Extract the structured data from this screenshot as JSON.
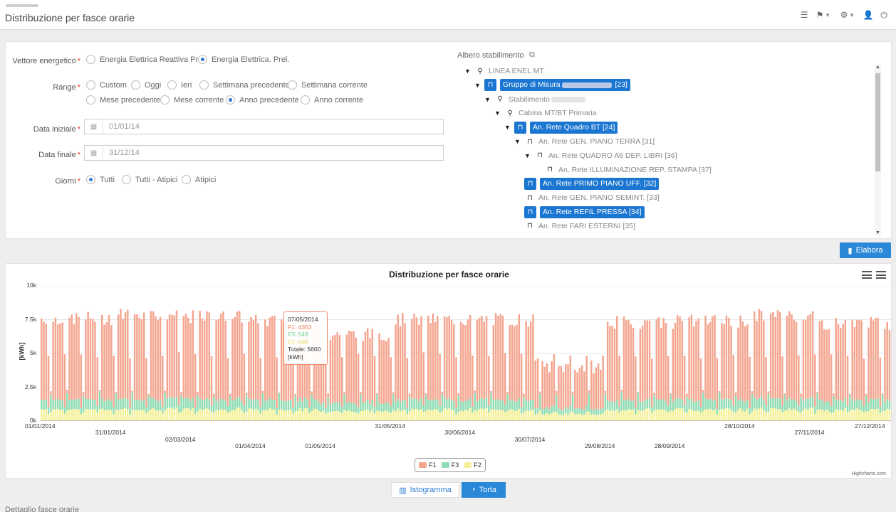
{
  "header": {
    "title": "Distribuzione per fasce orarie",
    "icons": [
      "list-icon",
      "flag-icon",
      "gear-icon",
      "user-icon",
      "power-icon"
    ]
  },
  "form": {
    "vettore": {
      "label": "Vettore energetico",
      "options": [
        "Energia Elettrica Reattiva Prel.",
        "Energia Elettrica. Prel."
      ],
      "selected": "Energia Elettrica. Prel."
    },
    "range": {
      "label": "Range",
      "options_row1": [
        "Custom",
        "Oggi",
        "Ieri",
        "Settimana precedente",
        "Settimana corrente"
      ],
      "options_row2": [
        "Mese precedente",
        "Mese corrente",
        "Anno precedente",
        "Anno corrente"
      ],
      "selected": "Anno precedente"
    },
    "data_iniziale": {
      "label": "Data iniziale",
      "value": "01/01/14"
    },
    "data_finale": {
      "label": "Data finale",
      "value": "31/12/14"
    },
    "giorni": {
      "label": "Giorni",
      "options": [
        "Tutti",
        "Tutti - Atipici",
        "Atipici"
      ],
      "selected": "Tutti"
    },
    "required_mark": "*"
  },
  "tree": {
    "title": "Albero stabilimento",
    "nodes": [
      {
        "label": "LINEA ENEL MT",
        "level": 0,
        "caret": true,
        "icon": "map-marker-icon",
        "selected": false
      },
      {
        "label": "Gruppo di Misura",
        "suffix": "[23]",
        "level": 1,
        "caret": true,
        "icon": "inbox-icon",
        "selected": true,
        "blur": true
      },
      {
        "label": "Stabilimento",
        "level": 2,
        "caret": true,
        "icon": "map-marker-icon",
        "selected": false,
        "blur": true
      },
      {
        "label": "Cabina MT/BT Primaria",
        "level": 3,
        "caret": true,
        "icon": "map-marker-icon",
        "selected": false
      },
      {
        "label": "An. Rete Quadro BT [24]",
        "level": 4,
        "caret": true,
        "icon": "inbox-icon",
        "selected": true
      },
      {
        "label": "An. Rete GEN. PIANO TERRA [31]",
        "level": 5,
        "caret": true,
        "icon": "inbox-icon",
        "selected": false
      },
      {
        "label": "An. Rete QUADRO A6 DEP. LIBRI [36]",
        "level": 6,
        "caret": true,
        "icon": "inbox-icon",
        "selected": false
      },
      {
        "label": "An. Rete ILLUMINAZIONE REP. STAMPA [37]",
        "level": 7,
        "caret": false,
        "icon": "inbox-icon",
        "selected": false
      },
      {
        "label": "An. Rete PRIMO PIANO UFF. [32]",
        "level": 5,
        "caret": false,
        "icon": "inbox-icon",
        "selected": true
      },
      {
        "label": "An. Rete GEN. PIANO SEMINT. [33]",
        "level": 5,
        "caret": false,
        "icon": "inbox-icon",
        "selected": false
      },
      {
        "label": "An. Rete REFIL PRESSA [34]",
        "level": 5,
        "caret": false,
        "icon": "inbox-icon",
        "selected": true
      },
      {
        "label": "An. Rete FARI ESTERNI [35]",
        "level": 5,
        "caret": false,
        "icon": "inbox-icon",
        "selected": false
      }
    ]
  },
  "actions": {
    "elabora": "Elabora",
    "istogramma": "Istogramma",
    "torta": "Torta"
  },
  "footer_text": "Dettaglio fasce orarie",
  "colors": {
    "F1": "#f4a58f",
    "F3": "#8fdcb4",
    "F2": "#f5f19b",
    "accent": "#2a88d8"
  },
  "chart_data": {
    "type": "bar",
    "stacked": true,
    "title": "Distribuzione per fasce orarie",
    "ylabel": "[kWh]",
    "ylim": [
      0,
      10000
    ],
    "yticks": [
      "0k",
      "2.5k",
      "5k",
      "7.5k",
      "10k"
    ],
    "x_start": "01/01/2014",
    "x_end": "31/12/2014",
    "xticks": [
      "01/01/2014",
      "31/01/2014",
      "02/03/2014",
      "01/04/2014",
      "01/05/2014",
      "31/05/2014",
      "30/06/2014",
      "30/07/2014",
      "29/08/2014",
      "28/09/2014",
      "28/10/2014",
      "27/11/2014",
      "27/12/2014"
    ],
    "series_order": [
      "F1",
      "F3",
      "F2"
    ],
    "legend": [
      "F1",
      "F3",
      "F2"
    ],
    "monthly_typical_weekday_totals": {
      "gen": 7600,
      "feb": 7900,
      "mar": 7700,
      "apr": 7400,
      "mag": 6400,
      "giu": 7500,
      "lug": 7500,
      "ago": 4000,
      "set": 7300,
      "ott": 7400,
      "nov": 7800,
      "dic": 7200
    },
    "tooltip": {
      "date": "07/05/2014",
      "lines": [
        "F1: 4353",
        "F3: 549",
        "F2: 698"
      ],
      "total": "Totale: 5600",
      "unit": "[kWh]"
    },
    "credits": "Highcharts.com"
  }
}
